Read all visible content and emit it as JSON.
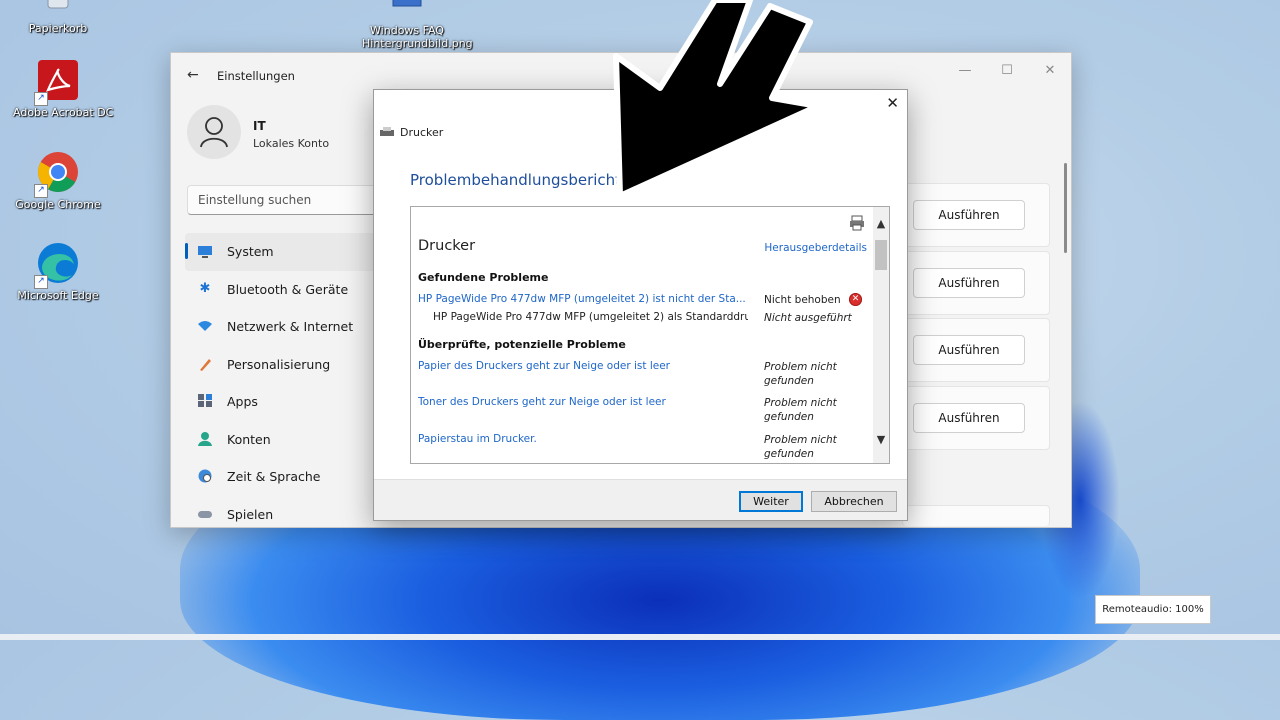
{
  "desktop": {
    "icons": [
      {
        "label": "Papierkorb"
      },
      {
        "label": "Adobe Acrobat DC"
      },
      {
        "label": "Google Chrome"
      },
      {
        "label": "Microsoft Edge"
      },
      {
        "label": "Windows FAQ\nHintergrundbild.png"
      }
    ]
  },
  "settings": {
    "title": "Einstellungen",
    "user": {
      "name": "IT",
      "sub": "Lokales Konto"
    },
    "search_placeholder": "Einstellung suchen",
    "nav": [
      {
        "label": "System",
        "icon": "monitor-icon"
      },
      {
        "label": "Bluetooth & Geräte",
        "icon": "bluetooth-icon"
      },
      {
        "label": "Netzwerk & Internet",
        "icon": "wifi-icon"
      },
      {
        "label": "Personalisierung",
        "icon": "brush-icon"
      },
      {
        "label": "Apps",
        "icon": "apps-icon"
      },
      {
        "label": "Konten",
        "icon": "person-icon"
      },
      {
        "label": "Zeit & Sprache",
        "icon": "globe-clock-icon"
      },
      {
        "label": "Spielen",
        "icon": "gamepad-icon"
      }
    ],
    "run_buttons": [
      "Ausführen",
      "Ausführen",
      "Ausführen",
      "Ausführen"
    ]
  },
  "dialog": {
    "window_title": "Drucker",
    "heading": "Problembehandlungsbericht",
    "report": {
      "title": "Drucker",
      "publisher_link": "Herausgeberdetails",
      "found_section": "Gefundene Probleme",
      "found": [
        {
          "text": "HP PageWide Pro 477dw MFP (umgeleitet 2) ist nicht der Sta...",
          "status": "Nicht behoben"
        },
        {
          "text": "HP PageWide Pro 477dw MFP (umgeleitet 2) als Standarddru...",
          "status": "Nicht ausgeführt"
        }
      ],
      "checked_section": "Überprüfte, potenzielle Probleme",
      "checked": [
        {
          "text": "Papier des Druckers geht zur Neige oder ist leer",
          "status": "Problem nicht gefunden"
        },
        {
          "text": "Toner des Druckers geht zur Neige oder ist leer",
          "status": "Problem nicht gefunden"
        },
        {
          "text": "Papierstau im Drucker.",
          "status": "Problem nicht gefunden"
        }
      ]
    },
    "buttons": {
      "next": "Weiter",
      "cancel": "Abbrechen"
    }
  },
  "remote_audio": "Remoteaudio: 100%"
}
